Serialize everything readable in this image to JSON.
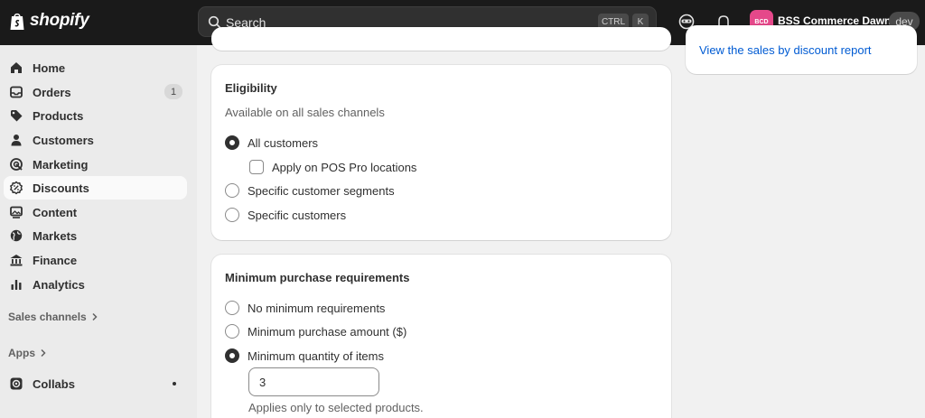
{
  "topbar": {
    "logo_text": "shopify",
    "search_placeholder": "Search",
    "shortcut_ctrl": "CTRL",
    "shortcut_k": "K",
    "avatar_initials": "BCD",
    "store_name": "BSS Commerce Dawn",
    "env_badge": "dev",
    "colors": {
      "background": "#1a1a1a",
      "avatar": "#e5488a"
    }
  },
  "sidebar": {
    "items": [
      {
        "label": "Home",
        "icon": "home-icon"
      },
      {
        "label": "Orders",
        "icon": "inbox-icon",
        "badge": "1"
      },
      {
        "label": "Products",
        "icon": "tag-icon"
      },
      {
        "label": "Customers",
        "icon": "person-icon"
      },
      {
        "label": "Marketing",
        "icon": "target-icon"
      },
      {
        "label": "Discounts",
        "icon": "discount-icon",
        "active": true
      },
      {
        "label": "Content",
        "icon": "image-icon"
      },
      {
        "label": "Markets",
        "icon": "globe-icon"
      },
      {
        "label": "Finance",
        "icon": "bank-icon"
      },
      {
        "label": "Analytics",
        "icon": "bar-chart-icon"
      }
    ],
    "sales_channels_label": "Sales channels",
    "apps_label": "Apps",
    "collabs_label": "Collabs"
  },
  "eligibility": {
    "title": "Eligibility",
    "subtitle": "Available on all sales channels",
    "options": [
      {
        "label": "All customers",
        "checked": true
      },
      {
        "label": "Specific customer segments",
        "checked": false
      },
      {
        "label": "Specific customers",
        "checked": false
      }
    ],
    "pos_checkbox_label": "Apply on POS Pro locations"
  },
  "minimum_requirements": {
    "title": "Minimum purchase requirements",
    "options": [
      {
        "label": "No minimum requirements",
        "checked": false
      },
      {
        "label": "Minimum purchase amount ($)",
        "checked": false
      },
      {
        "label": "Minimum quantity of items",
        "checked": true
      }
    ],
    "quantity_value": "3",
    "helper_text": "Applies only to selected products."
  },
  "side_card": {
    "report_link": "View the sales by discount report"
  }
}
